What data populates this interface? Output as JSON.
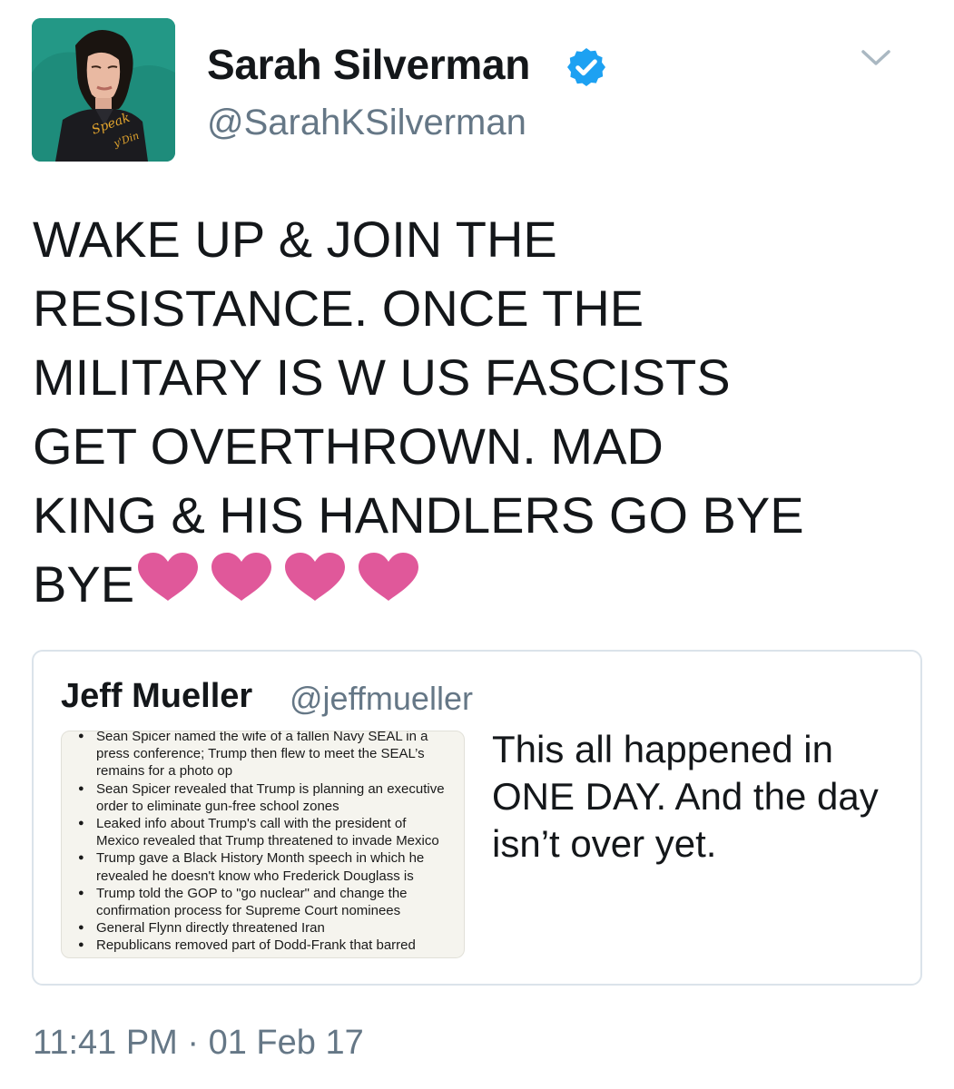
{
  "author": {
    "display_name": "Sarah Silverman",
    "handle": "@SarahKSilverman",
    "verified": true,
    "avatar_icon": "profile-photo",
    "avatar_shirt_text": "Speak y'Din"
  },
  "tweet": {
    "text_line_1": "WAKE UP & JOIN THE",
    "text_line_2": "RESISTANCE.  ONCE THE",
    "text_line_3": "MILITARY IS W US FASCISTS",
    "text_line_4": "GET OVERTHROWN. MAD",
    "text_line_5": "KING & HIS HANDLERS GO BYE",
    "text_line_6": "BYE",
    "emoji": [
      "heart-icon",
      "heart-icon",
      "heart-icon",
      "heart-icon"
    ],
    "heart_color": "#e0589a"
  },
  "quoted_tweet": {
    "name": "Jeff Mueller",
    "handle": "@jeffmueller",
    "text": "This all happened in\nONE DAY. And the day\nisn’t over yet.",
    "image_bullets": [
      "Sean Spicer named the wife of a fallen Navy SEAL in a\npress conference; Trump then flew to meet the SEAL’s\nremains for a photo op",
      "Sean Spicer revealed that Trump is planning an executive\norder to eliminate gun-free school zones",
      "Leaked info about Trump's call with the president of\nMexico revealed that Trump threatened to invade Mexico",
      "Trump gave a Black History Month speech in which he\nrevealed he doesn't know who Frederick Douglass is",
      "Trump told the GOP to \"go nuclear\" and change the\nconfirmation process for Supreme Court nominees",
      "General Flynn directly threatened Iran",
      "Republicans removed part of Dodd-Frank that barred"
    ]
  },
  "timestamp": "11:41 PM · 01 Feb 17",
  "colors": {
    "verified_blue": "#1da1f2",
    "secondary_text": "#657786",
    "border": "#dbe3ea"
  }
}
